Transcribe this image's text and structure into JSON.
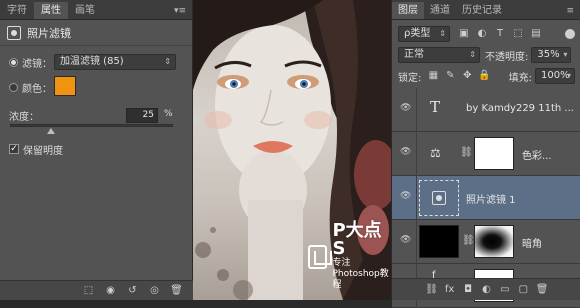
{
  "left_panel": {
    "tabs": [
      "字符",
      "属性",
      "画笔"
    ],
    "active_tab": "属性",
    "header_title": "照片滤镜",
    "filter_label": "滤镜：",
    "filter_value": "加温滤镜 (85)",
    "color_label": "颜色：",
    "color_swatch": "#f0930f",
    "density_label": "浓度：",
    "density_value": "25",
    "density_unit": "%",
    "density_level_percent": 25,
    "preserve_label": "保留明度",
    "preserve_checked": true
  },
  "photo": {
    "watermark_title": "P大点S",
    "watermark_subtitle": "专注Photoshop教程"
  },
  "right_panel": {
    "tabs": [
      "图层",
      "通道",
      "历史记录"
    ],
    "active_tab": "图层",
    "kind_filter": "ρ类型",
    "blend_mode": "正常",
    "opacity_label": "不透明度:",
    "opacity_value": "35%",
    "lock_label": "锁定:",
    "fill_label": "填充:",
    "fill_value": "100%",
    "layers": [
      {
        "name": "by Kamdy229 11th ...",
        "type": "text"
      },
      {
        "name": "色彩...",
        "type": "adjustment"
      },
      {
        "name": "照片滤镜 1",
        "type": "photo-filter",
        "selected": true
      },
      {
        "name": "暗角",
        "type": "mask"
      },
      {
        "name": "",
        "type": "adjustment"
      }
    ]
  }
}
